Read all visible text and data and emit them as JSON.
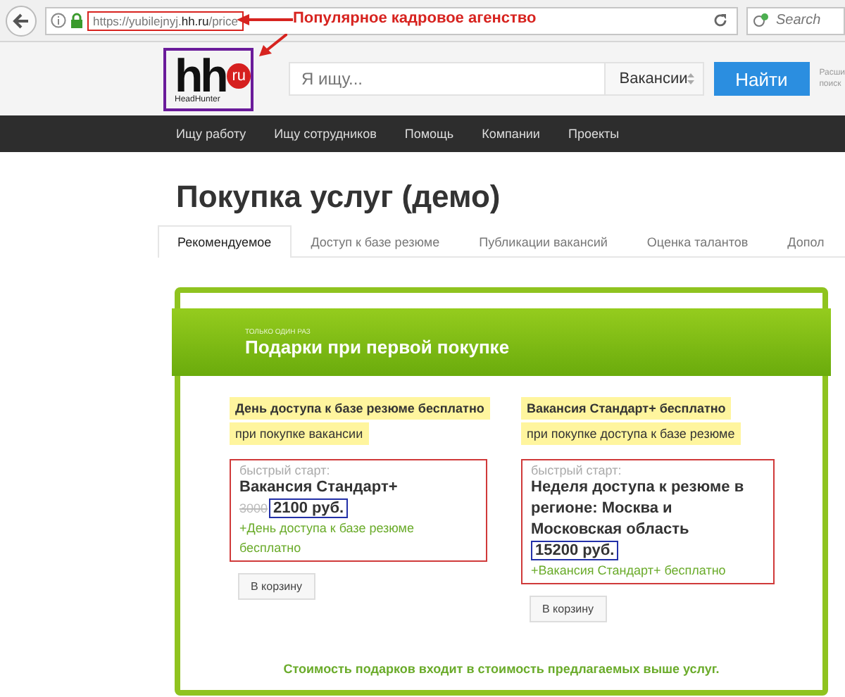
{
  "browser": {
    "url": "https://yubilejnyj.**hh.ru**/price",
    "search_placeholder": "Search"
  },
  "annotation": {
    "text": "Популярное кадровое агенство"
  },
  "header": {
    "logo": {
      "text": "hh",
      "badge": "ru",
      "caption": "HeadHunter"
    },
    "search_placeholder": "Я ищу...",
    "select": "Вакансии",
    "button": "Найти",
    "side_text": [
      "Расши",
      "поиск"
    ]
  },
  "nav": [
    "Ищу работу",
    "Ищу сотрудников",
    "Помощь",
    "Компании",
    "Проекты"
  ],
  "title": "Покупка услуг (демо)",
  "tabs": [
    {
      "label": "Рекомендуемое",
      "selected": true
    },
    {
      "label": "Доступ к базе резюме",
      "selected": false
    },
    {
      "label": "Публикации вакансий",
      "selected": false
    },
    {
      "label": "Оценка талантов",
      "selected": false
    },
    {
      "label": "Допол",
      "selected": false
    }
  ],
  "promo": {
    "kicker": "ТОЛЬКО ОДИН РАЗ",
    "title": "Подарки при первой покупке",
    "gifts": [
      {
        "title": "День доступа к базе резюме бесплатно",
        "subtitle": "при покупке вакансии"
      },
      {
        "title": "Вакансия Стандарт+ бесплатно",
        "subtitle": "при покупке доступа к базе резюме"
      }
    ],
    "offers": [
      {
        "kicker": "быстрый старт:",
        "name": "Вакансия Стандарт+",
        "old_price": "3000",
        "price": "2100 руб.",
        "bonus": "+День доступа к базе резюме бесплатно",
        "button": "В корзину"
      },
      {
        "kicker": "быстрый старт:",
        "name": "Неделя доступа к резюме в регионе: Москва и Московская область",
        "price": "15200 руб.",
        "bonus": "+Вакансия Стандарт+ бесплатно",
        "button": "В корзину"
      }
    ],
    "note": "Стоимость подарков входит в стоимость предлагаемых выше услуг."
  }
}
